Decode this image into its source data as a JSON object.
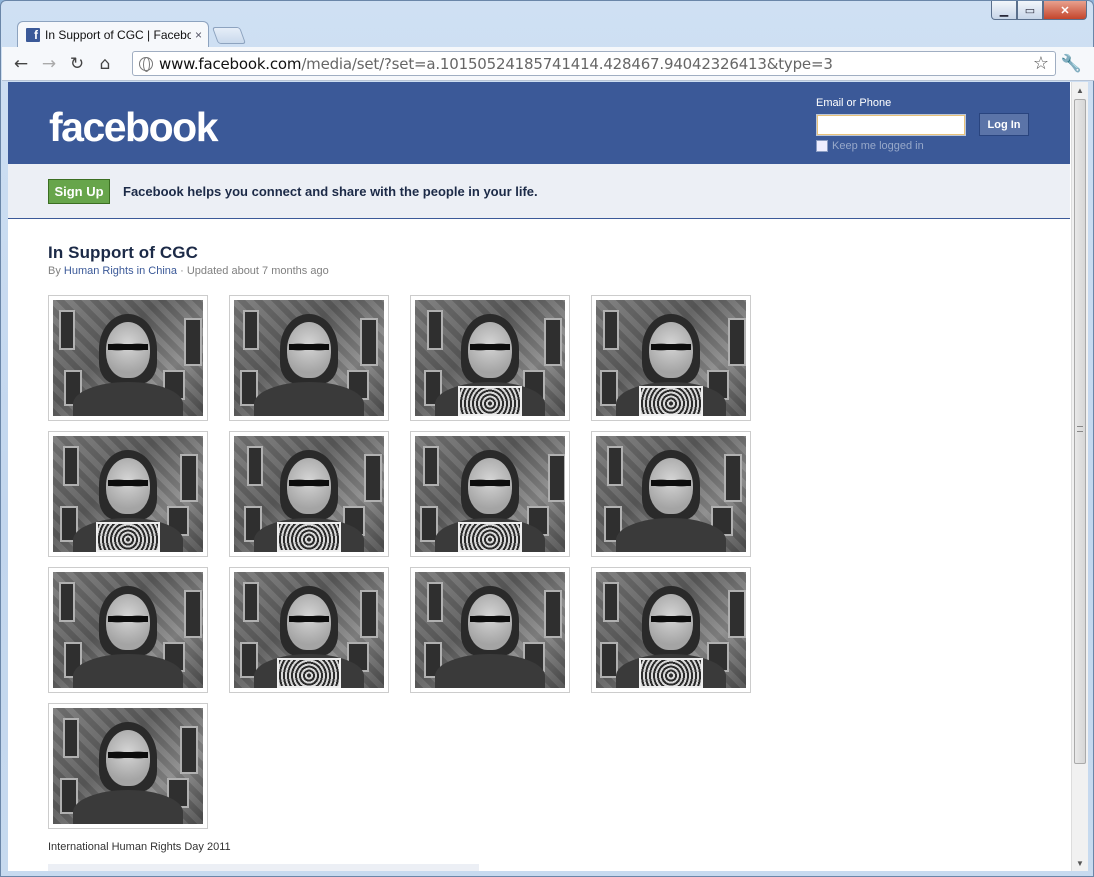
{
  "browser": {
    "tab_title": "In Support of CGC | Facebo",
    "tab_close": "×",
    "url_host": "www.facebook.com",
    "url_rest": "/media/set/?set=a.10150524185741414.428467.94042326413&type=3",
    "icons": [
      "back-icon",
      "forward-icon",
      "reload-icon",
      "home-icon",
      "globe-icon",
      "star-icon",
      "wrench-icon"
    ]
  },
  "header": {
    "logo": "facebook",
    "email_label": "Email or Phone",
    "login_button": "Log In",
    "keep_logged_in": "Keep me logged in"
  },
  "signup": {
    "button": "Sign Up",
    "tagline": "Facebook helps you connect and share with the people in your life."
  },
  "album": {
    "title": "In Support of CGC",
    "by_prefix": "By",
    "author": "Human Rights in China",
    "updated": "· Updated about 7 months ago",
    "photo_count": 13,
    "caption": "International Human Rights Day 2011"
  },
  "colors": {
    "brand_blue": "#3b5998",
    "signup_green": "#67a54b",
    "bar_bg": "#eceff5"
  }
}
